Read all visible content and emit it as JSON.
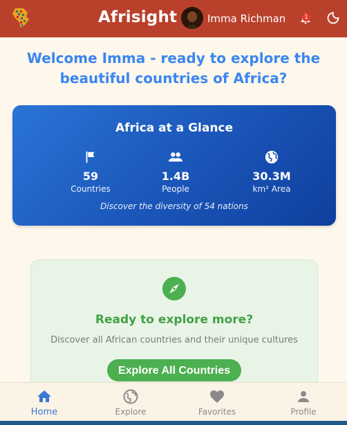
{
  "header": {
    "title": "Afrisight",
    "user_name": "Imma Richman",
    "notification_count": "1"
  },
  "welcome": {
    "message": "Welcome Imma - ready to explore the beautiful countries of Africa?"
  },
  "glance": {
    "title": "Africa at a Glance",
    "stats": [
      {
        "icon": "flag-icon",
        "value": "59",
        "label": "Countries"
      },
      {
        "icon": "people-icon",
        "value": "1.4B",
        "label": "People"
      },
      {
        "icon": "globe-icon",
        "value": "30.3M",
        "label": "km² Area"
      }
    ],
    "footnote": "Discover the diversity of 54 nations"
  },
  "explore": {
    "icon": "compass-icon",
    "title": "Ready to explore more?",
    "subtitle": "Discover all African countries and their unique cultures",
    "button_label": "Explore All Countries"
  },
  "nav": {
    "items": [
      {
        "icon": "home-icon",
        "label": "Home",
        "active": true
      },
      {
        "icon": "globe-icon",
        "label": "Explore",
        "active": false
      },
      {
        "icon": "heart-icon",
        "label": "Favorites",
        "active": false
      },
      {
        "icon": "person-icon",
        "label": "Profile",
        "active": false
      }
    ]
  },
  "colors": {
    "header_bg": "#b9412c",
    "welcome_text": "#3b86ef",
    "glance_bg": "#1a55b8",
    "accent_green": "#4caf50",
    "nav_active": "#3a78d4"
  }
}
